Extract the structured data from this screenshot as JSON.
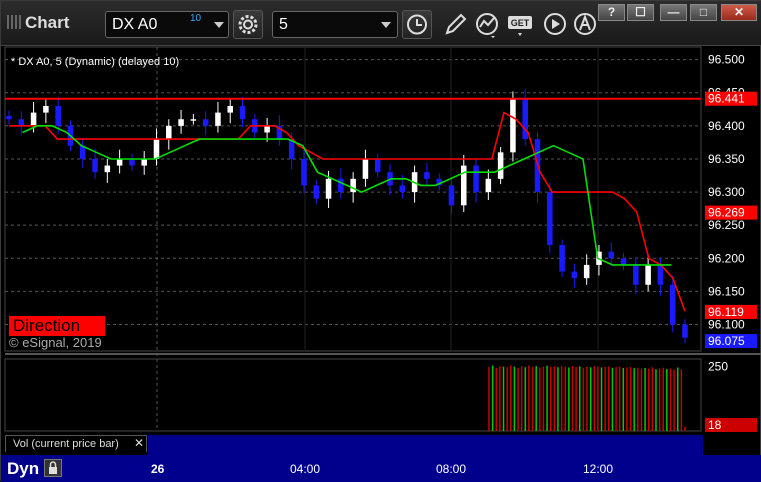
{
  "window": {
    "title": "Chart",
    "controls": [
      "?",
      "☐",
      "—",
      "□",
      "✕"
    ]
  },
  "toolbar": {
    "symbol": "DX A0",
    "symbol_delay": "10",
    "interval": "5",
    "icons": [
      "settings-gear-icon",
      "clock-icon",
      "pencil-draw-icon",
      "studies-icon",
      "get-icon",
      "play-icon",
      "alert-icon"
    ],
    "get_label": "GET"
  },
  "study_label": "* DX A0, 5 (Dynamic) (delayed 10)",
  "direction_label": "Direction",
  "copyright": "© eSignal, 2019",
  "volume_pane": {
    "tab_label": "Vol (current price bar)",
    "close": "✕",
    "axis_label": "250",
    "current_volume": "18"
  },
  "bottom_bar": {
    "mode_label": "Dyn",
    "x_ticks": [
      {
        "label": "26",
        "bold": true
      },
      {
        "label": "04:00",
        "bold": false
      },
      {
        "label": "08:00",
        "bold": false
      },
      {
        "label": "12:00",
        "bold": false
      }
    ]
  },
  "colors": {
    "background": "#000000",
    "up_candle": "#ffffff",
    "down_candle": "#1a1aff",
    "red_line": "#ff0000",
    "green_line": "#00e000",
    "time_bar": "#00008c"
  },
  "chart_data": {
    "type": "candlestick",
    "symbol": "DX A0",
    "interval_minutes": 5,
    "ylim": [
      96.06,
      96.51
    ],
    "y_ticks": [
      "96.500",
      "96.450",
      "96.400",
      "96.350",
      "96.300",
      "96.250",
      "96.200",
      "96.150",
      "96.100"
    ],
    "price_labels": [
      {
        "value": 96.441,
        "text": "96.441",
        "bg": "#ff0000"
      },
      {
        "value": 96.269,
        "text": "96.269",
        "bg": "#ff0000"
      },
      {
        "value": 96.119,
        "text": "96.119",
        "bg": "#ff0000"
      },
      {
        "value": 96.075,
        "text": "96.075",
        "bg": "#1a1aff"
      }
    ],
    "horizontal_line": 96.441,
    "series": [
      {
        "name": "Close",
        "values": [
          96.41,
          96.4,
          96.42,
          96.43,
          96.4,
          96.37,
          96.35,
          96.33,
          96.34,
          96.35,
          96.34,
          96.35,
          96.38,
          96.4,
          96.41,
          96.41,
          96.4,
          96.42,
          96.43,
          96.41,
          96.39,
          96.4,
          96.38,
          96.35,
          96.31,
          96.29,
          96.32,
          96.3,
          96.32,
          96.35,
          96.33,
          96.31,
          96.3,
          96.33,
          96.32,
          96.31,
          96.28,
          96.34,
          96.3,
          96.32,
          96.36,
          96.44,
          96.38,
          96.3,
          96.22,
          96.18,
          96.17,
          96.19,
          96.21,
          96.2,
          96.19,
          96.16,
          96.19,
          96.16,
          96.1,
          96.08
        ]
      },
      {
        "name": "Red MA",
        "values": [
          96.4,
          96.4,
          96.4,
          96.4,
          96.38,
          96.38,
          96.38,
          96.38,
          96.38,
          96.38,
          96.38,
          96.38,
          96.38,
          96.38,
          96.38,
          96.38,
          96.38,
          96.38,
          96.38,
          96.38,
          96.4,
          96.4,
          96.4,
          96.39,
          96.37,
          96.36,
          96.35,
          96.35,
          96.35,
          96.35,
          96.35,
          96.35,
          96.35,
          96.35,
          96.35,
          96.35,
          96.35,
          96.35,
          96.35,
          96.35,
          96.35,
          96.42,
          96.41,
          96.39,
          96.33,
          96.3,
          96.3,
          96.3,
          96.3,
          96.3,
          96.3,
          96.29,
          96.27,
          96.2,
          96.19,
          96.17,
          96.12
        ]
      },
      {
        "name": "Green MA",
        "values": [
          96.39,
          96.4,
          96.4,
          96.39,
          96.37,
          96.36,
          96.35,
          96.35,
          96.35,
          96.35,
          96.36,
          96.37,
          96.38,
          96.38,
          96.38,
          96.38,
          96.38,
          96.38,
          96.38,
          96.37,
          96.33,
          96.32,
          96.31,
          96.3,
          96.31,
          96.32,
          96.32,
          96.31,
          96.31,
          96.32,
          96.33,
          96.33,
          96.33,
          96.34,
          96.35,
          96.36,
          96.37,
          96.36,
          96.35,
          96.2,
          96.19,
          96.19,
          96.19,
          96.19,
          96.19
        ]
      }
    ],
    "volume": {
      "ylim": [
        0,
        280
      ],
      "values": [
        250,
        255,
        245,
        252,
        250,
        248,
        255,
        250,
        246,
        252,
        248,
        255,
        250,
        252,
        247,
        250,
        254,
        249,
        251,
        248,
        253,
        250,
        247,
        252,
        249,
        251,
        246,
        250,
        248,
        252,
        250,
        247,
        249,
        251,
        246,
        248,
        250,
        245,
        247,
        249,
        244,
        246,
        243,
        245,
        242,
        248,
        240,
        244,
        246,
        241,
        243,
        238,
        247,
        240,
        18
      ]
    }
  }
}
